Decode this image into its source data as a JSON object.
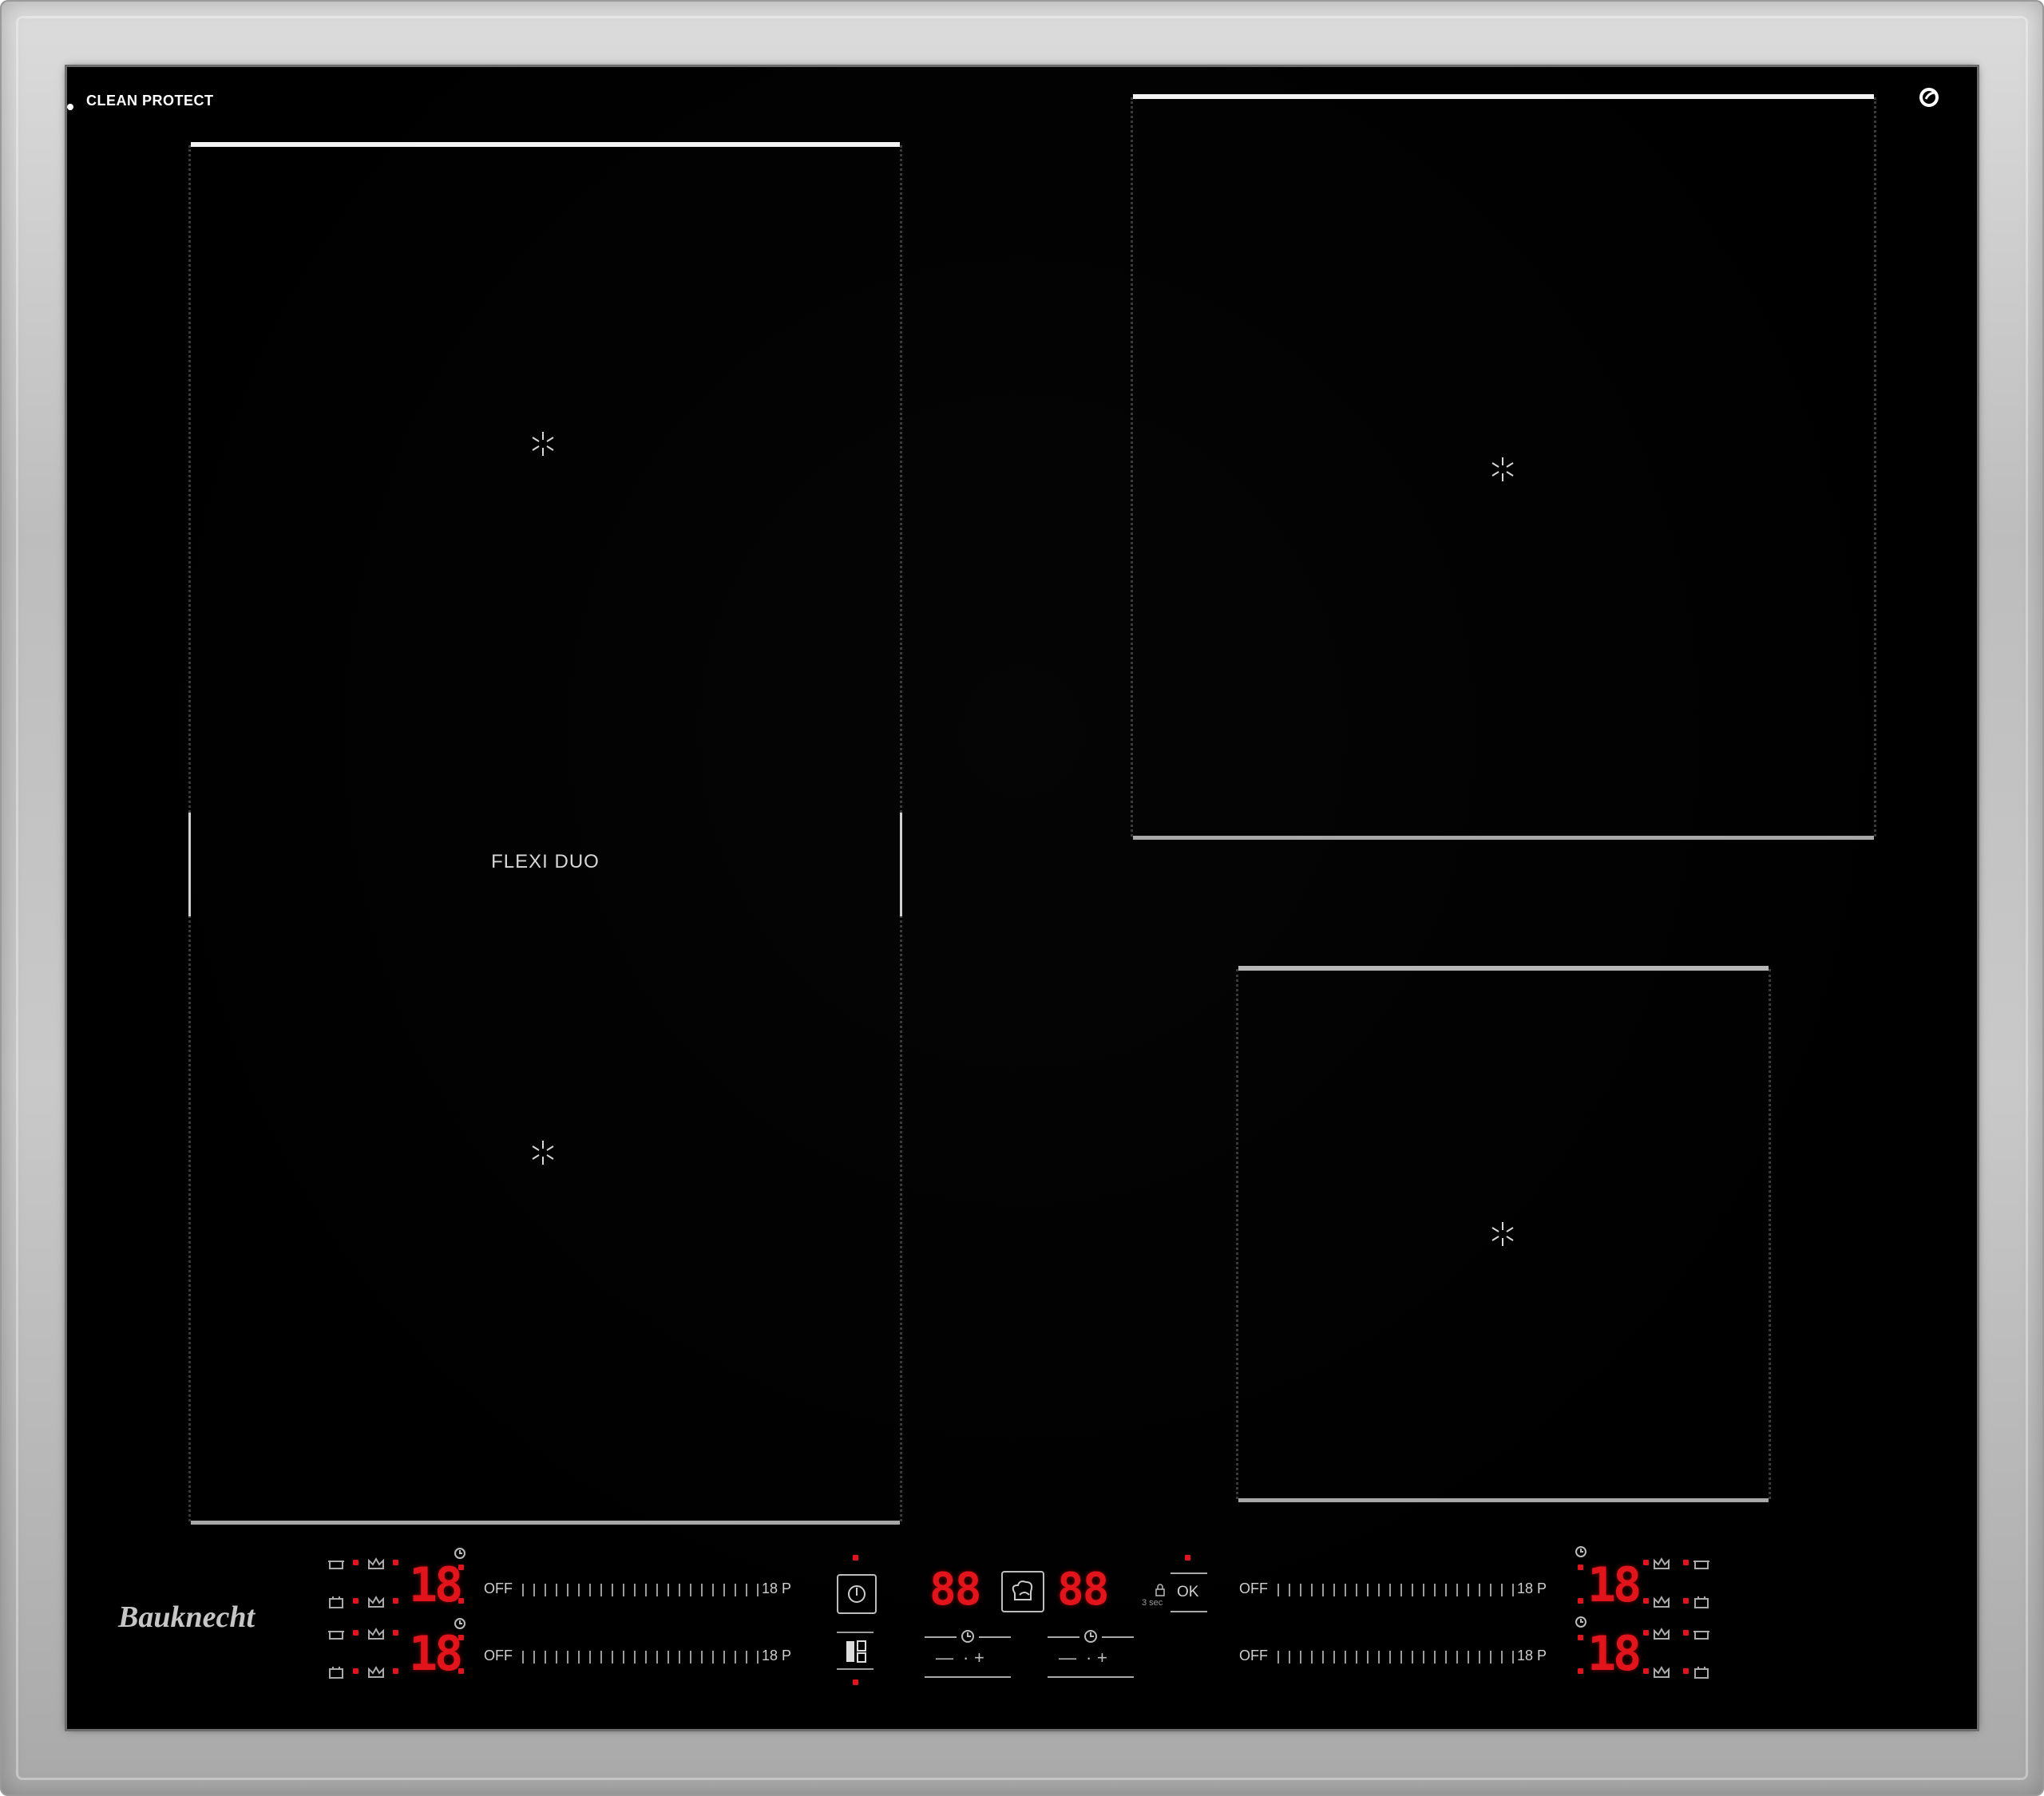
{
  "brand": {
    "top_left_mark": "CLEAN PROTECT",
    "logo": "Bauknecht"
  },
  "zones": {
    "flexi_label": "FLEXI DUO"
  },
  "controls": {
    "left": [
      {
        "display": "18",
        "off_label": "OFF",
        "max_label": "18 P"
      },
      {
        "display": "18",
        "off_label": "OFF",
        "max_label": "18 P"
      }
    ],
    "right": [
      {
        "display": "18",
        "off_label": "OFF",
        "max_label": "18 P"
      },
      {
        "display": "18",
        "off_label": "OFF",
        "max_label": "18 P"
      }
    ],
    "center": {
      "timer_left": "88",
      "timer_right": "88",
      "lock_hint": "3 sec",
      "ok_label": "OK",
      "minus": "—",
      "dot": "·",
      "plus": "+"
    }
  },
  "icons": {
    "cross": "cooking-zone-center-icon",
    "power": "power-icon",
    "flexi": "flexi-zone-icon",
    "chef": "chef-hat-icon",
    "lock": "lock-icon",
    "timer": "timer-icon",
    "pot": "pot-icon",
    "crown": "boost-crown-icon",
    "pan": "pan-icon",
    "eco": "eco-icon"
  },
  "colors": {
    "glass": "#000000",
    "frame": "#c4c4c4",
    "display_red": "#e2141b",
    "zone_line": "#f4f4f4"
  }
}
